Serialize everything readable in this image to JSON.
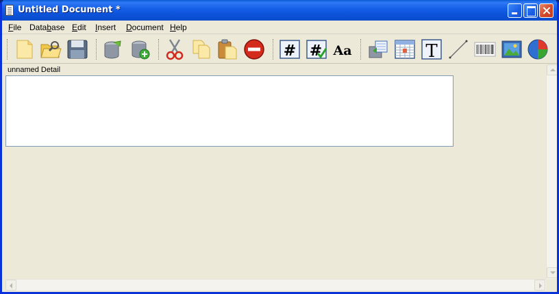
{
  "window": {
    "title": "Untitled Document *"
  },
  "menu": [
    {
      "key": "F",
      "rest": "ile"
    },
    {
      "pre": "Data",
      "key": "b",
      "rest": "ase"
    },
    {
      "key": "E",
      "rest": "dit"
    },
    {
      "key": "I",
      "rest": "nsert"
    },
    {
      "key": "D",
      "rest": "ocument"
    },
    {
      "key": "H",
      "rest": "elp"
    }
  ],
  "toolbar": {
    "icons": [
      "new-document-icon",
      "open-folder-icon",
      "save-disk-icon",
      "database-icon",
      "add-database-icon",
      "scissors-cut-icon",
      "copy-icon",
      "paste-clipboard-icon",
      "delete-stop-icon",
      "number-field-icon",
      "number-check-icon",
      "text-font-aa-icon",
      "merge-field-icon",
      "table-grid-icon",
      "text-frame-icon",
      "line-tool-icon",
      "barcode-icon",
      "image-icon",
      "pie-chart-icon"
    ],
    "aa_label": "Aa",
    "hash_label": "#",
    "t_label": "T"
  },
  "document": {
    "detail_label": "unnamed Detail"
  },
  "colors": {
    "title_blue": "#0b53d9",
    "close_red": "#d1482a",
    "face": "#ece9d8"
  }
}
